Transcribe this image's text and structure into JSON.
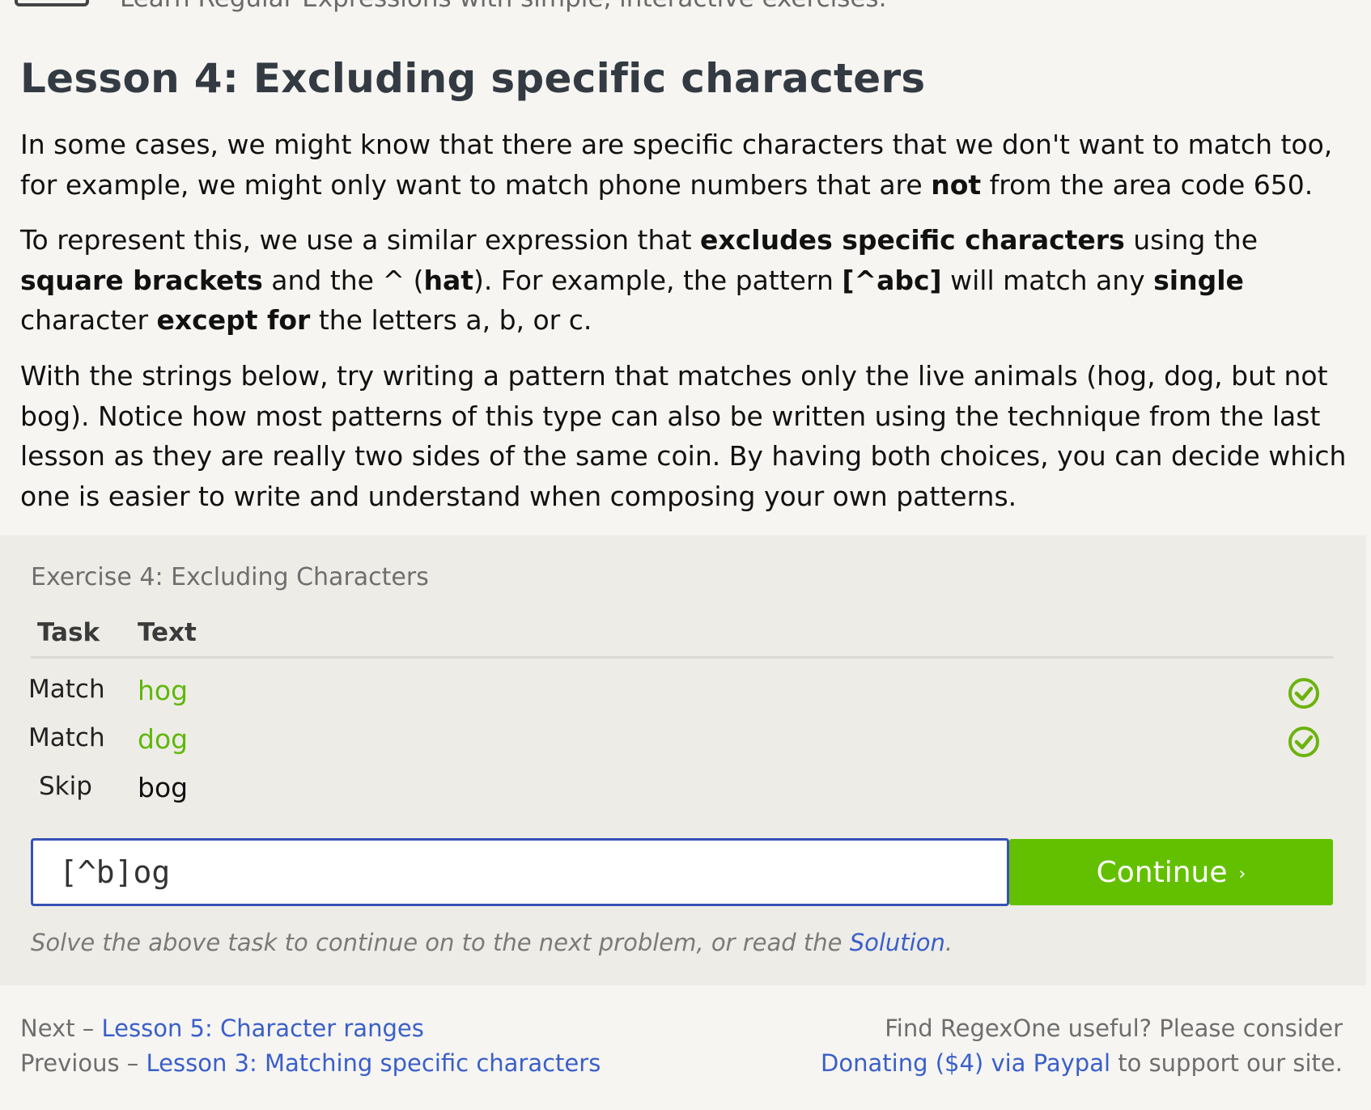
{
  "header": {
    "tagline": "Learn Regular Expressions with simple, interactive exercises."
  },
  "lesson": {
    "title": "Lesson 4: Excluding specific characters",
    "para1": [
      "In some cases, we might know that there are specific characters that we don't want to match too, for example, we might only want to match phone numbers that are ",
      "not",
      " from the area code 650."
    ],
    "para2": [
      "To represent this, we use a similar expression that ",
      "excludes specific characters",
      " using the ",
      "square brackets",
      " and the ^ (",
      "hat",
      "). For example, the pattern ",
      "[^abc]",
      " will match any ",
      "single",
      " character ",
      "except for",
      " the letters a, b, or c."
    ],
    "para3": "With the strings below, try writing a pattern that matches only the live animals (hog, dog, but not bog). Notice how most patterns of this type can also be written using the technique from the last lesson as they are really two sides of the same coin. By having both choices, you can decide which one is easier to write and understand when composing your own patterns."
  },
  "exercise": {
    "title": "Exercise 4: Excluding Characters",
    "columns": [
      "Task",
      "Text"
    ],
    "rows": [
      {
        "task": "Match",
        "text": "hog",
        "status": "matched"
      },
      {
        "task": "Match",
        "text": "dog",
        "status": "matched"
      },
      {
        "task": "Skip",
        "text": "bog",
        "status": "none"
      }
    ],
    "input_value": "[^b]og",
    "continue_label": "Continue",
    "continue_chevron": "›",
    "hint_prefix": "Solve the above task to continue on to the next problem, or read the ",
    "hint_link": "Solution",
    "hint_suffix": "."
  },
  "footer": {
    "next_prefix": "Next – ",
    "next_link": "Lesson 5: Character ranges",
    "prev_prefix": "Previous – ",
    "prev_link": "Lesson 3: Matching specific characters",
    "donate_line1": "Find RegexOne useful? Please consider",
    "donate_link": "Donating ($4) via Paypal",
    "donate_suffix": " to support our site."
  },
  "colors": {
    "match_green": "#5fb80a",
    "button_green": "#63c000",
    "link_blue": "#3a5fc9",
    "input_border": "#3552b5"
  },
  "icons": {
    "success": "check-circle-icon"
  }
}
